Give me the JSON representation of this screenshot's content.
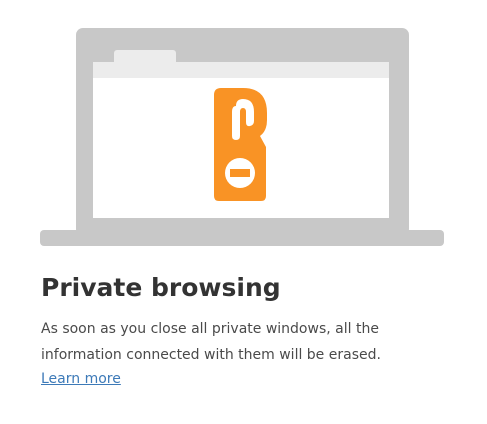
{
  "illustration": {
    "name": "private-browsing-laptop-illustration",
    "icon": "door-hanger-icon",
    "colors": {
      "laptop": "#c8c8c8",
      "screen_frame": "#ececec",
      "screen": "#ffffff",
      "hanger": "#f99325"
    }
  },
  "heading": {
    "title": "Private browsing",
    "description": "As soon as you close all private windows, all the information connected with them will be erased.",
    "learn_more_label": "Learn more"
  },
  "colors": {
    "title_text": "#333333",
    "body_text": "#4a4a4a",
    "link": "#3d7ab8"
  }
}
